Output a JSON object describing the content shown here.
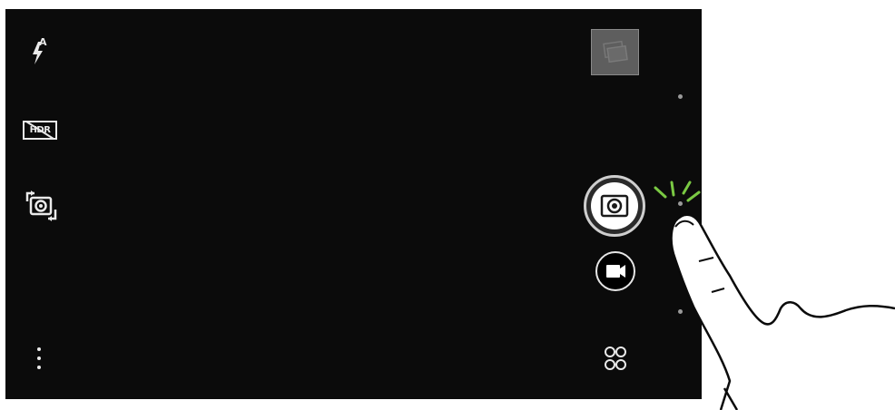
{
  "camera": {
    "flash_mode_sup": "A",
    "hdr_label": "HDR",
    "colors": {
      "viewfinder_bg": "#0b0b0b",
      "icon": "#eaeaea",
      "tap_highlight": "#7ac943"
    },
    "left_controls": [
      {
        "name": "flash-auto-icon"
      },
      {
        "name": "hdr-off-icon"
      },
      {
        "name": "switch-camera-icon"
      },
      {
        "name": "more-menu-icon"
      }
    ],
    "right_controls": [
      {
        "name": "gallery-thumbnail"
      },
      {
        "name": "photo-shutter-button"
      },
      {
        "name": "video-record-button"
      },
      {
        "name": "camera-modes-icon"
      }
    ],
    "overlay": {
      "name": "tap-gesture-hand-illustration"
    }
  }
}
